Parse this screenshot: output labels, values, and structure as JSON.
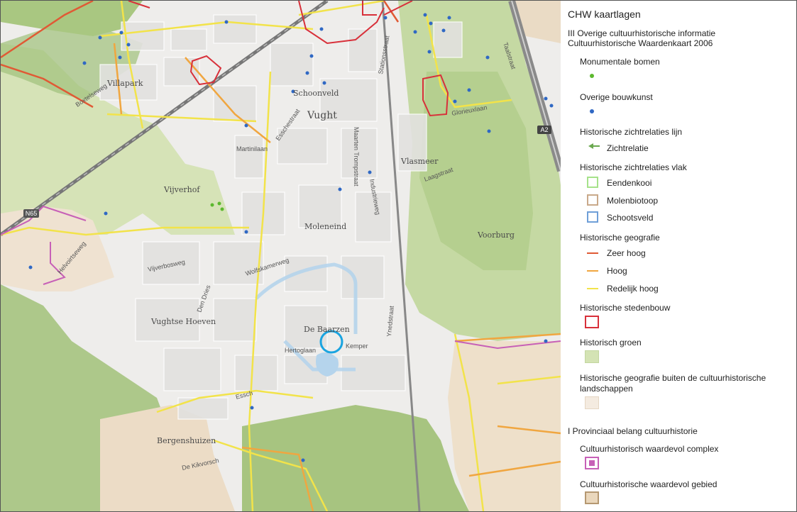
{
  "legend": {
    "title": "CHW kaartlagen",
    "section3_line1": "III Overige cultuurhistorische informatie",
    "section3_line2": "Cultuurhistorische Waardenkaart 2006",
    "monumentale_bomen": "Monumentale bomen",
    "overige_bouwkunst": "Overige bouwkunst",
    "zichtrelaties_lijn": "Historische zichtrelaties lijn",
    "zichtrelatie": "Zichtrelatie",
    "zichtrelaties_vlak": "Historische zichtrelaties vlak",
    "eendenkooi": "Eendenkooi",
    "molenbiotoop": "Molenbiotoop",
    "schootsveld": "Schootsveld",
    "historische_geografie": "Historische geografie",
    "zeer_hoog": "Zeer hoog",
    "hoog": "Hoog",
    "redelijk_hoog": "Redelijk hoog",
    "historische_stedenbouw": "Historische stedenbouw",
    "historisch_groen": "Historisch groen",
    "buiten_line1": "Historische geografie buiten de cultuurhistorische",
    "buiten_line2": "landschappen",
    "section1": "I Provinciaal belang cultuurhistorie",
    "complex": "Cultuurhistorisch waardevol complex",
    "gebied": "Cultuurhistorische waardevol gebied",
    "colors": {
      "monument_dot": "#5cb82e",
      "bouwkunst_dot": "#2f68c4",
      "zichtrelatie_arrow": "#6aa84f",
      "eendenkooi": "#a6e28a",
      "molenbiotoop": "#c9a98a",
      "schootsveld": "#6f9fd8",
      "zeer_hoog": "#e05a35",
      "hoog": "#f0a640",
      "redelijk_hoog": "#f2e34a",
      "stedenbouw": "#d8303a",
      "groen_fill": "#d4e3b4",
      "buiten_fill": "#f4ebe0",
      "complex_border": "#c760b7",
      "gebied_fill": "#ead7bc",
      "gebied_border": "#b59871"
    }
  },
  "map": {
    "places": {
      "villapark": "Villapark",
      "schoonveld": "Schoonveld",
      "vught": "Vught",
      "vlasmeer": "Vlasmeer",
      "vijverhof": "Vijverhof",
      "moleneind": "Moleneind",
      "voorburg": "Voorburg",
      "vughtse_hoeven": "Vughtse Hoeven",
      "de_baarzen": "De Baarzen",
      "bergenshuizen": "Bergenshuizen"
    },
    "streets": {
      "martinilaan": "Martinilaan",
      "esschestraat": "Esschestraat",
      "taalstraat": "Taalstraat",
      "maarten_tromp": "Maarten Trompstraat",
      "industrieweg": "Industrieweg",
      "laagstraat": "Laagstraat",
      "glorieuxlaan": "Glorieuxlaan",
      "wolfskamerweg": "Wolfskamerweg",
      "vijverbosweg": "Vijverbosweg",
      "den_dries": "Den Dries",
      "hertoglaan": "Hertoglaan",
      "kemper": "Kemper",
      "ynedstraat": "Ynedstraat",
      "essche": "Essch",
      "de_kikvorsch": "De Kikvorsch",
      "boxtelseweg": "Boxtelseweg",
      "helvoirtseweg": "Helvoirtseweg",
      "a2": "A2",
      "n65": "N65",
      "stationsstraat": "Stationsstraat"
    }
  }
}
